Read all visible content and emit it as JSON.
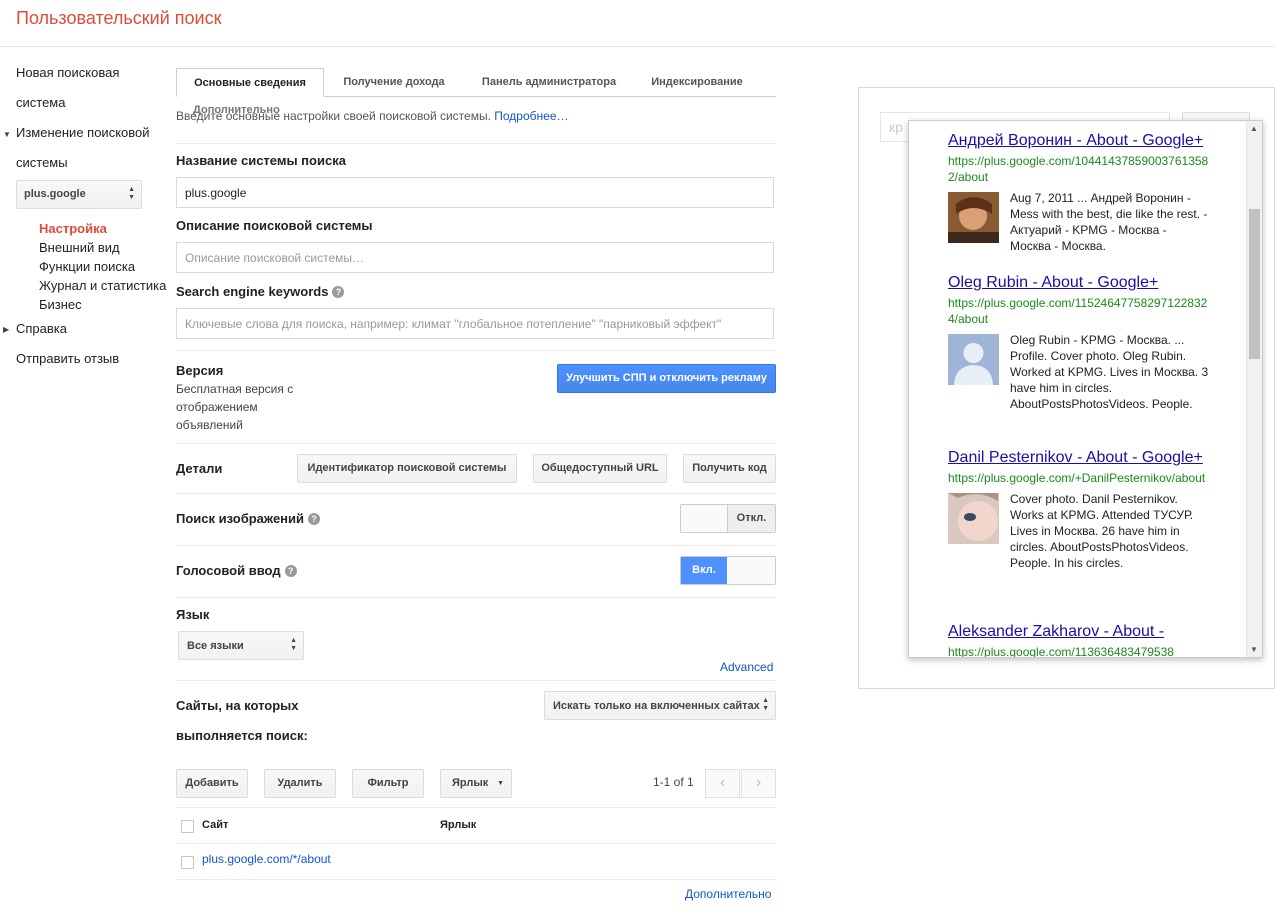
{
  "app": {
    "title": "Пользовательский поиск"
  },
  "sidebar": {
    "new_engine_line1": "Новая поисковая",
    "new_engine_line2": "система",
    "edit_engine_line1": "Изменение поисковой",
    "edit_engine_line2": "системы",
    "engine_select_value": "plus.google",
    "subitems": [
      {
        "label": "Настройка"
      },
      {
        "label": "Внешний вид"
      },
      {
        "label": "Функции поиска"
      },
      {
        "label": "Журнал и статистика"
      },
      {
        "label": "Бизнес"
      }
    ],
    "help": "Справка",
    "feedback": "Отправить отзыв"
  },
  "tabs": {
    "basics": "Основные сведения",
    "monetization": "Получение дохода",
    "admin": "Панель администратора",
    "indexing": "Индексирование",
    "more": "Дополнительно"
  },
  "intro": {
    "text": "Введите основные настройки своей поисковой системы. ",
    "link": "Подробнее…"
  },
  "fields": {
    "name_label": "Название системы поиска",
    "name_value": "plus.google",
    "desc_label": "Описание поисковой системы",
    "desc_placeholder": "Описание поисковой системы…",
    "keywords_label": "Search engine keywords",
    "keywords_placeholder": "Ключевые слова для поиска, например: климат \"глобальное потепление\" \"парниковый эффект\""
  },
  "edition": {
    "label": "Версия",
    "description": "Бесплатная версия с отображением объявлений",
    "upgrade_button": "Улучшить СПП и отключить рекламу"
  },
  "details": {
    "label": "Детали",
    "engine_id_button": "Идентификатор поисковой системы",
    "public_url_button": "Общедоступный URL",
    "get_code_button": "Получить код"
  },
  "image_search": {
    "label": "Поиск изображений",
    "toggle_off": "Откл."
  },
  "voice_search": {
    "label": "Голосовой ввод",
    "toggle_on": "Вкл."
  },
  "language": {
    "label": "Язык",
    "value": "Все языки",
    "advanced_link": "Advanced"
  },
  "sites": {
    "label_line1": "Сайты, на которых",
    "label_line2": "выполняется поиск:",
    "mode_value": "Искать только на включенных сайтах",
    "add_button": "Добавить",
    "delete_button": "Удалить",
    "filter_button": "Фильтр",
    "label_button": "Ярлык",
    "pager": "1-1 of 1",
    "col_site": "Сайт",
    "col_label": "Ярлык",
    "rows": [
      {
        "site": "plus.google.com/*/about"
      }
    ],
    "more_link": "Дополнительно"
  },
  "preview": {
    "search_placeholder": "кр",
    "results": [
      {
        "title": "Андрей Воронин - About - Google+",
        "url": "https://plus.google.com/104414378590037613582/about",
        "snippet": "Aug 7, 2011 ... Андрей Воронин - Mess with the best, die like the rest. - Актуарий - KPMG - Москва - Москва - Москва."
      },
      {
        "title": "Oleg Rubin - About - Google+",
        "url": "https://plus.google.com/115246477582971228324/about",
        "snippet": "Oleg Rubin - KPMG - Москва. ... Profile. Cover photo. Oleg Rubin. Worked at KPMG. Lives in Москва. 3 have him in circles. AboutPostsPhotosVideos. People."
      },
      {
        "title": "Danil Pesternikov - About - Google+",
        "url": "https://plus.google.com/+DanilPesternikov/about",
        "snippet": "Cover photo. Danil Pesternikov. Works at KPMG. Attended ТУСУР. Lives in Москва. 26 have him in circles. AboutPostsPhotosVideos. People. In his circles."
      },
      {
        "title": "Aleksander Zakharov - About -",
        "url": "https://plus.google.com/113636483479538",
        "snippet": ""
      }
    ]
  },
  "colors": {
    "brand_red": "#dd4b39",
    "accent_blue": "#4d90fe",
    "link_blue": "#1155cc",
    "url_green": "#1a8a1a"
  }
}
